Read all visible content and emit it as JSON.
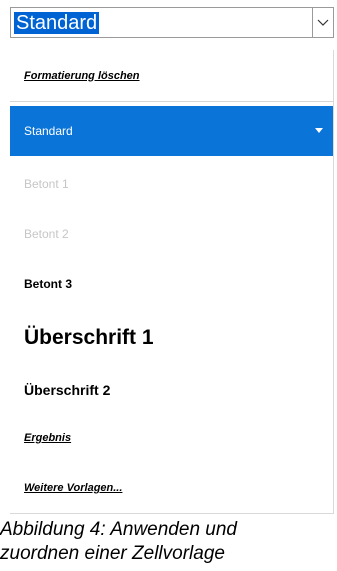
{
  "combo": {
    "value": "Standard"
  },
  "dropdown": {
    "items": [
      {
        "label": "Formatierung löschen"
      },
      {
        "label": "Standard"
      },
      {
        "label": "Betont 1"
      },
      {
        "label": "Betont 2"
      },
      {
        "label": "Betont 3"
      },
      {
        "label": "Überschrift 1"
      },
      {
        "label": "Überschrift 2"
      },
      {
        "label": "Ergebnis"
      },
      {
        "label": "Weitere Vorlagen..."
      }
    ]
  },
  "caption": {
    "line1": "Abbildung 4: Anwenden und",
    "line2": "zuordnen einer Zellvorlage"
  },
  "colors": {
    "accent": "#0a74d9",
    "muted": "#c6c6c6"
  }
}
